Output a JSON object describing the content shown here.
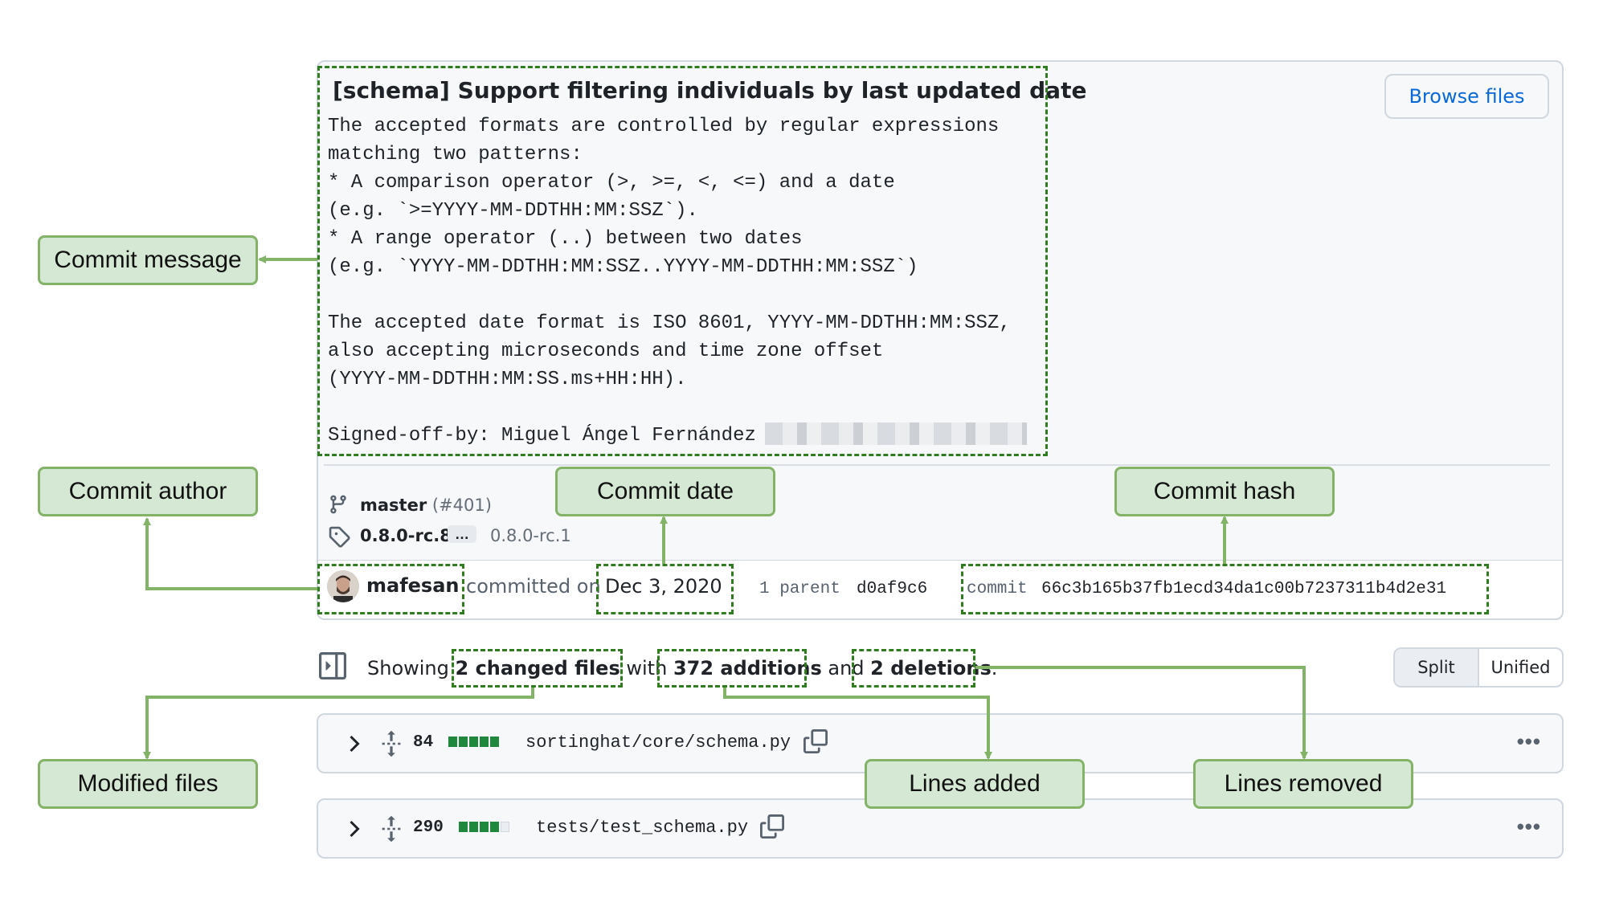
{
  "commit": {
    "title": "[schema] Support filtering individuals by last updated date",
    "message": "The accepted formats are controlled by regular expressions\nmatching two patterns:\n* A comparison operator (>, >=, <, <=) and a date\n(e.g. `>=YYYY-MM-DDTHH:MM:SSZ`).\n* A range operator (..) between two dates\n(e.g. `YYYY-MM-DDTHH:MM:SSZ..YYYY-MM-DDTHH:MM:SSZ`)\n\nThe accepted date format is ISO 8601, YYYY-MM-DDTHH:MM:SSZ,\nalso accepting microseconds and time zone offset\n(YYYY-MM-DDTHH:MM:SS.ms+HH:HH).\n\nSigned-off-by: Miguel Ángel Fernández",
    "browse_label": "Browse files",
    "branch": "master",
    "pr_ref": "(#401)",
    "tag_latest": "0.8.0-rc.8",
    "tag_ellipsis": "…",
    "tag_oldest": "0.8.0-rc.1",
    "author": "mafesan",
    "committed_on": "committed on",
    "date": "Dec 3, 2020",
    "parent_label": "1 parent",
    "parent_hash": "d0af9c6",
    "commit_label": "commit",
    "commit_hash": "66c3b165b37fb1ecd34da1c00b7237311b4d2e31"
  },
  "diff_summary": {
    "showing": "Showing",
    "changed_files": "2 changed files",
    "with": "with",
    "additions": "372 additions",
    "and": "and",
    "deletions": "2 deletions",
    "period": ".",
    "split_label": "Split",
    "unified_label": "Unified"
  },
  "files": [
    {
      "count": "84",
      "path": "sortinghat/core/schema.py",
      "diffstat": [
        "add",
        "add",
        "add",
        "add",
        "add"
      ]
    },
    {
      "count": "290",
      "path": "tests/test_schema.py",
      "diffstat": [
        "add",
        "add",
        "add",
        "add",
        "neutral"
      ]
    }
  ],
  "annotations": {
    "commit_message": "Commit message",
    "commit_author": "Commit author",
    "commit_date": "Commit date",
    "commit_hash": "Commit hash",
    "modified_files": "Modified files",
    "lines_added": "Lines added",
    "lines_removed": "Lines removed"
  },
  "colors": {
    "callout_fill": "#d5e8d4",
    "callout_border": "#82b366",
    "dashed_highlight": "#2f7d1f",
    "diff_add": "#1f883d",
    "link_blue": "#0969da"
  },
  "icons": [
    "git-branch-icon",
    "tag-icon",
    "avatar",
    "sidebar-toggle-icon",
    "chevron-right-icon",
    "expand-icon",
    "copy-icon",
    "kebab-icon"
  ]
}
